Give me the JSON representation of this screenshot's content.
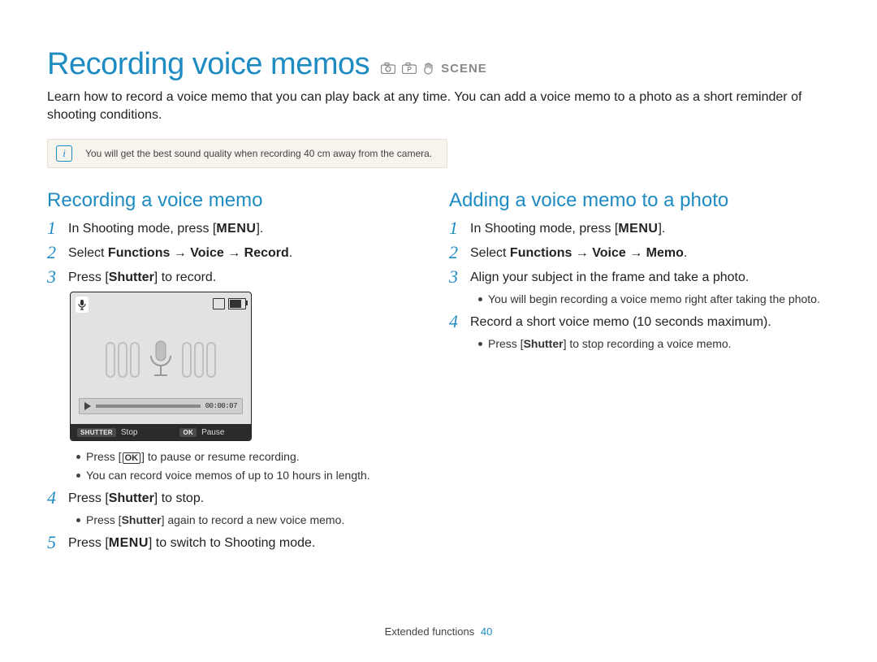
{
  "title": "Recording voice memos",
  "mode_icons": {
    "scene_label": "SCENE"
  },
  "intro": "Learn how to record a voice memo that you can play back at any time. You can add a voice memo to a photo as a short reminder of shooting conditions.",
  "tip": "You will get the best sound quality when recording 40 cm away from the camera.",
  "left": {
    "heading": "Recording a voice memo",
    "step1_pre": "In Shooting mode, press [",
    "step1_btn": "MENU",
    "step1_post": "].",
    "step2_pre": "Select ",
    "step2_b1": "Functions",
    "step2_arrow": " → ",
    "step2_b2": "Voice",
    "step2_b3": "Record",
    "step2_dot": ".",
    "step3_pre": "Press [",
    "step3_b": "Shutter",
    "step3_post": "] to record.",
    "screenshot": {
      "time": "00:00:07",
      "shutter_key": "SHUTTER",
      "stop_label": "Stop",
      "ok_key": "OK",
      "pause_label": "Pause"
    },
    "bullet_a_pre": "Press [",
    "bullet_a_ok": "OK",
    "bullet_a_post": "] to pause or resume recording.",
    "bullet_b": "You can record voice memos of up to 10 hours in length.",
    "step4_pre": "Press [",
    "step4_b": "Shutter",
    "step4_post": "] to stop.",
    "bullet_c_pre": "Press [",
    "bullet_c_b": "Shutter",
    "bullet_c_post": "] again to record a new voice memo.",
    "step5_pre": "Press [",
    "step5_btn": "MENU",
    "step5_post": "] to switch to Shooting mode."
  },
  "right": {
    "heading": "Adding a voice memo to a photo",
    "step1_pre": "In Shooting mode, press [",
    "step1_btn": "MENU",
    "step1_post": "].",
    "step2_pre": "Select ",
    "step2_b1": "Functions",
    "step2_arrow": " → ",
    "step2_b2": "Voice",
    "step2_b3": "Memo",
    "step2_dot": ".",
    "step3": "Align your subject in the frame and take a photo.",
    "bullet_a": "You will begin recording a voice memo right after taking the photo.",
    "step4": "Record a short voice memo (10 seconds maximum).",
    "bullet_b_pre": "Press [",
    "bullet_b_b": "Shutter",
    "bullet_b_post": "] to stop recording a voice memo."
  },
  "footer": {
    "section": "Extended functions",
    "page": "40"
  }
}
